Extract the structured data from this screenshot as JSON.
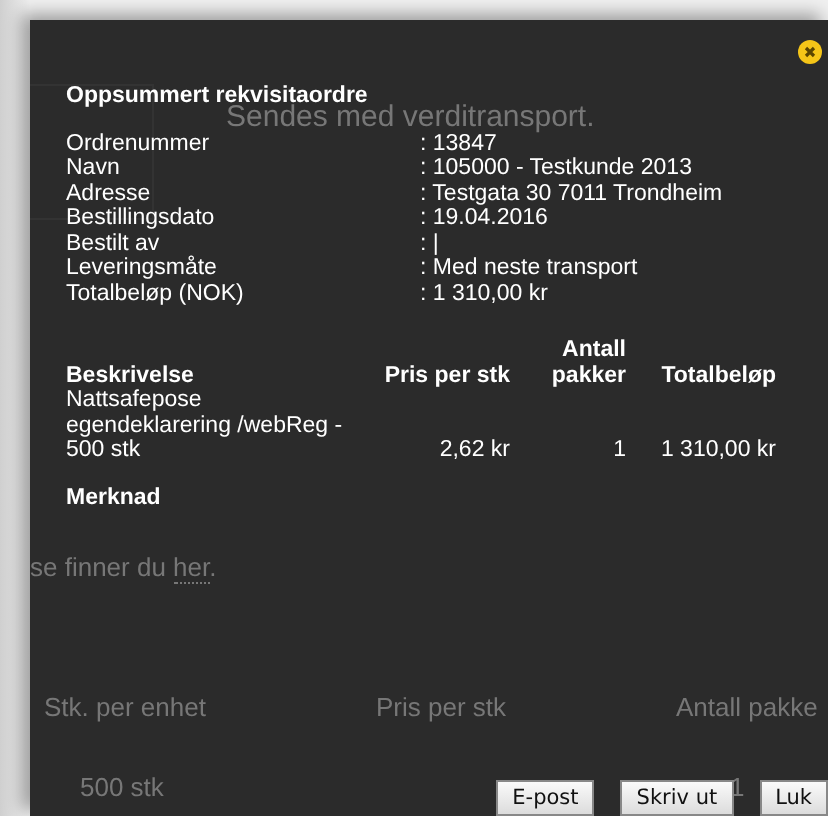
{
  "background_page": {
    "notice": "Sendes med verditransport.",
    "link_sentence": "se finner du **her**.",
    "columns": [
      "Stk. per enhet",
      "Pris per stk",
      "Antall pakke"
    ],
    "row": [
      "500 stk",
      "1"
    ]
  },
  "dialog": {
    "title": "Oppsummert rekvisitaordre",
    "fields": [
      {
        "label": "Ordrenummer",
        "value": ": 13847"
      },
      {
        "label": "Navn",
        "value": ": 105000 - Testkunde 2013"
      },
      {
        "label": "Adresse",
        "value": ": Testgata 30 7011 Trondheim"
      },
      {
        "label": "Bestillingsdato",
        "value": ": 19.04.2016"
      },
      {
        "label": "Bestilt av",
        "value": ": |"
      },
      {
        "label": "Leveringsmåte",
        "value": ": Med neste transport"
      },
      {
        "label": "Totalbeløp (NOK)",
        "value": ": 1 310,00 kr"
      }
    ],
    "table": {
      "columns": [
        "Beskrivelse",
        "Pris per stk",
        "Antall pakker",
        "Totalbeløp"
      ],
      "rows": [
        [
          "Nattsafepose egendeklarering /webReg - 500 stk",
          "2,62 kr",
          "1",
          "1 310,00 kr"
        ]
      ]
    },
    "remark_label": "Merknad",
    "buttons": [
      "E-post",
      "Skriv ut",
      "Luk"
    ]
  }
}
